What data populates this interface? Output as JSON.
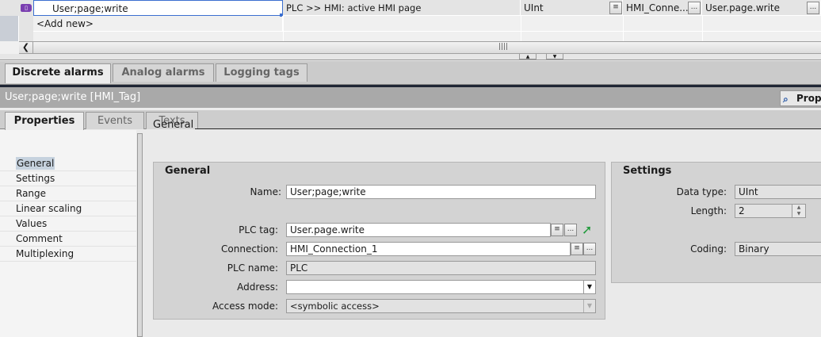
{
  "table": {
    "row": {
      "name": "User;page;write",
      "comment": "PLC >> HMI:  active HMI page",
      "data_type": "UInt",
      "connection": "HMI_Conne...",
      "plc_tag": "User.page.write"
    },
    "add_new": "<Add new>",
    "ellipsis": "..."
  },
  "bottom_tabs": [
    "Discrete alarms",
    "Analog alarms",
    "Logging tags"
  ],
  "inspector": {
    "title": "User;page;write [HMI_Tag]",
    "properties_button": "Prope",
    "tabs": [
      "Properties",
      "Events",
      "Texts"
    ]
  },
  "nav": [
    "General",
    "Settings",
    "Range",
    "Linear scaling",
    "Values",
    "Comment",
    "Multiplexing"
  ],
  "section_title": "General",
  "general": {
    "heading": "General",
    "name_label": "Name:",
    "name_value": "User;page;write",
    "plc_tag_label": "PLC tag:",
    "plc_tag_value": "User.page.write",
    "connection_label": "Connection:",
    "connection_value": "HMI_Connection_1",
    "plc_name_label": "PLC name:",
    "plc_name_value": "PLC",
    "address_label": "Address:",
    "address_value": "",
    "access_mode_label": "Access mode:",
    "access_mode_value": "<symbolic access>"
  },
  "settings": {
    "heading": "Settings",
    "data_type_label": "Data type:",
    "data_type_value": "UInt",
    "length_label": "Length:",
    "length_value": "2",
    "coding_label": "Coding:",
    "coding_value": "Binary"
  }
}
